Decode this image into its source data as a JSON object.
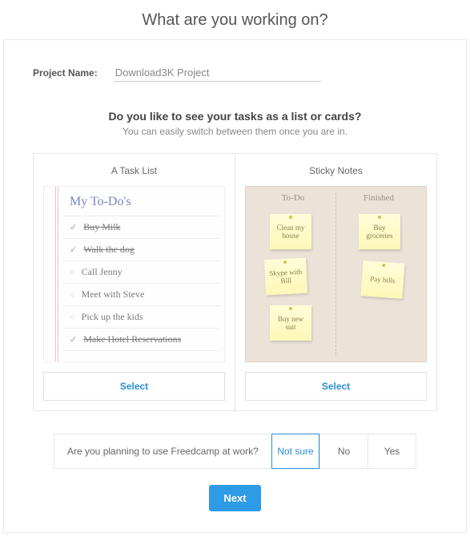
{
  "header": {
    "title": "What are you working on?"
  },
  "project": {
    "label": "Project Name:",
    "value": "Download3K Project"
  },
  "question": {
    "title": "Do you like to see your tasks as a list or cards?",
    "subtitle": "You can easily switch between them once you are in."
  },
  "options": {
    "list": {
      "title": "A Task List",
      "preview_title": "My To-Do's",
      "items": [
        {
          "text": "Buy Milk",
          "done": true
        },
        {
          "text": "Walk the dog",
          "done": true
        },
        {
          "text": "Call Jenny",
          "done": false
        },
        {
          "text": "Meet with Steve",
          "done": false
        },
        {
          "text": "Pick up the kids",
          "done": false
        },
        {
          "text": "Make Hotel Reservations",
          "done": true
        }
      ],
      "select_label": "Select"
    },
    "sticky": {
      "title": "Sticky Notes",
      "col_todo": "To-Do",
      "col_done": "Finished",
      "todo_notes": [
        "Clean my house",
        "Skype with Bill",
        "Buy new suit"
      ],
      "done_notes": [
        "Buy groceries",
        "Pay bills"
      ],
      "select_label": "Select"
    }
  },
  "work_question": {
    "text": "Are you planning to use Freedcamp at work?",
    "notsure": "Not sure",
    "no": "No",
    "yes": "Yes"
  },
  "next_label": "Next"
}
